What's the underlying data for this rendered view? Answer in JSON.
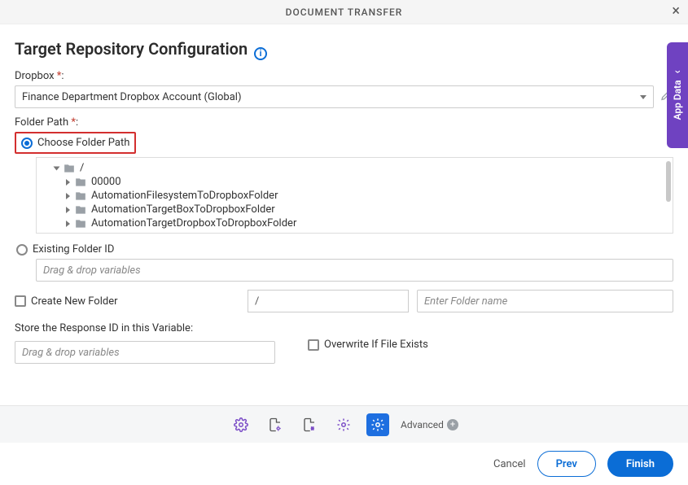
{
  "titlebar": {
    "title": "DOCUMENT TRANSFER"
  },
  "heading": "Target Repository Configuration",
  "side_tab": {
    "label": "App Data"
  },
  "dropbox": {
    "label": "Dropbox",
    "selected": "Finance Department Dropbox Account (Global)"
  },
  "folder_path": {
    "label": "Folder Path",
    "choose_label": "Choose Folder Path",
    "existing_label": "Existing Folder ID",
    "existing_placeholder": "Drag & drop variables"
  },
  "tree": {
    "root": "/",
    "children": [
      {
        "label": "00000"
      },
      {
        "label": "AutomationFilesystemToDropboxFolder"
      },
      {
        "label": "AutomationTargetBoxToDropboxFolder"
      },
      {
        "label": "AutomationTargetDropboxToDropboxFolder"
      }
    ]
  },
  "create_folder": {
    "label": "Create New Folder",
    "path_value": "/",
    "name_placeholder": "Enter Folder name"
  },
  "store_response": {
    "label": "Store the Response ID in this Variable:",
    "placeholder": "Drag & drop variables"
  },
  "overwrite": {
    "label": "Overwrite If File Exists"
  },
  "toolbar": {
    "advanced_label": "Advanced"
  },
  "footer": {
    "cancel": "Cancel",
    "prev": "Prev",
    "finish": "Finish"
  }
}
